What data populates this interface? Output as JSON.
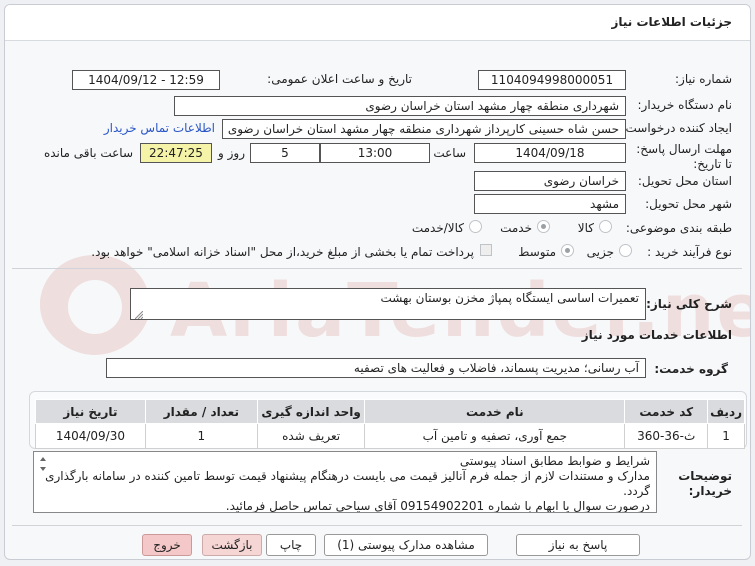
{
  "header": {
    "title": "جزئیات اطلاعات نیاز"
  },
  "labels": {
    "need_number": "شماره نیاز:",
    "announce_datetime": "تاریخ و ساعت اعلان عمومی:",
    "buyer_org": "نام دستگاه خریدار:",
    "requester": "ایجاد کننده درخواست:",
    "contact_link": "اطلاعات تماس خریدار",
    "deadline": "مهلت ارسال پاسخ: تا تاریخ:",
    "time": "ساعت",
    "days_and": "روز و",
    "remaining": "ساعت باقی مانده",
    "province": "استان محل تحویل:",
    "city": "شهر محل تحویل:",
    "category": "طبقه بندی موضوعی:",
    "process_type": "نوع فرآیند خرید :",
    "payment_note": "پرداخت تمام یا بخشی از مبلغ خرید،از محل \"اسناد خزانه اسلامی\" خواهد بود.",
    "summary": "شرح کلی نیاز:",
    "services_info": "اطلاعات خدمات مورد نیاز",
    "service_group": "گروه خدمت:",
    "buyer_notes": "توضیحات خریدار:"
  },
  "fields": {
    "need_number": "1104094998000051",
    "announce_datetime": "1404/09/12 - 12:59",
    "buyer_org": "شهرداری منطقه چهار مشهد استان خراسان رضوی",
    "requester": "حسن شاه حسینی کارپرداز شهرداری منطقه چهار مشهد استان خراسان رضوی",
    "deadline_date": "1404/09/18",
    "deadline_time": "13:00",
    "days": "5",
    "remaining_time": "22:47:25",
    "province": "خراسان رضوی",
    "city": "مشهد",
    "summary": "تعمیرات اساسی ایستگاه پمپاژ مخزن بوستان بهشت",
    "service_group": "آب رسانی؛ مدیریت پسماند، فاضلاب و فعالیت های تصفیه"
  },
  "category_options": [
    {
      "label": "کالا",
      "selected": false
    },
    {
      "label": "خدمت",
      "selected": true
    },
    {
      "label": "کالا/خدمت",
      "selected": false
    }
  ],
  "process_options": [
    {
      "label": "جزیی",
      "selected": false
    },
    {
      "label": "متوسط",
      "selected": true
    }
  ],
  "table": {
    "headers": [
      "ردیف",
      "کد خدمت",
      "نام خدمت",
      "واحد اندازه گیری",
      "تعداد / مقدار",
      "تاریخ نیاز"
    ],
    "rows": [
      [
        "1",
        "ث-36-360",
        "جمع آوری، تصفیه و تامین آب",
        "تعریف شده",
        "1",
        "1404/09/30"
      ]
    ]
  },
  "notes": {
    "lines": [
      "شرایط و ضوابط مطابق اسناد پیوستی",
      "مدارک و مستندات لازم از جمله فرم آنالیز قیمت می بایست درهنگام پیشنهاد قیمت توسط تامین کننده در سامانه بارگذاری گردد.",
      "درصورت سوال یا ابهام با شماره 09154902201 آقای سیاحی تماس حاصل فرمائید."
    ]
  },
  "buttons": {
    "reply": "پاسخ به نیاز",
    "view_docs": "مشاهده مدارک پیوستی (1)",
    "print": "چاپ",
    "back": "بازگشت",
    "exit": "خروج"
  },
  "watermark": {
    "text": "AriaTender.net"
  },
  "colors": {
    "link": "#2a56c6",
    "header_bg": "#ffffff",
    "table_header": "#d9dbde",
    "exit_button": "#f4c8c8"
  }
}
